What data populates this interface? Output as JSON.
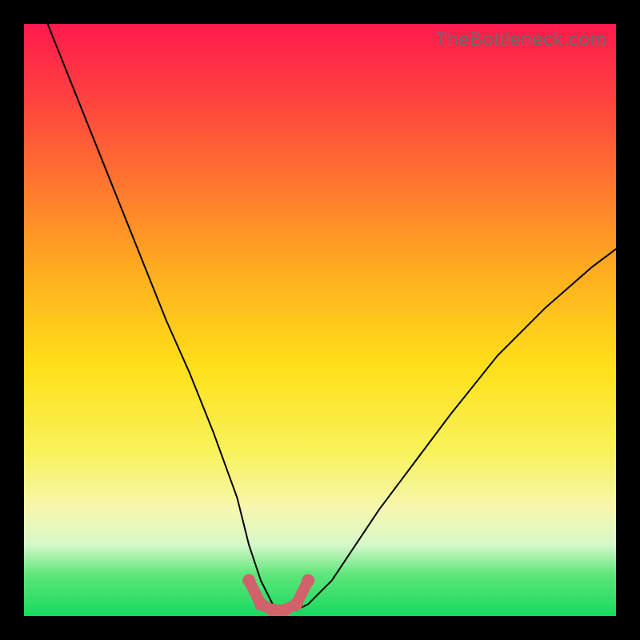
{
  "watermark": "TheBottleneck.com",
  "chart_data": {
    "type": "line",
    "title": "",
    "xlabel": "",
    "ylabel": "",
    "xlim": [
      0,
      100
    ],
    "ylim": [
      0,
      100
    ],
    "series": [
      {
        "name": "bottleneck-curve",
        "x": [
          4,
          8,
          12,
          16,
          20,
          24,
          28,
          32,
          36,
          38,
          40,
          42,
          44,
          46,
          48,
          52,
          56,
          60,
          66,
          72,
          80,
          88,
          96,
          100
        ],
        "y": [
          100,
          90,
          80,
          70,
          60,
          50,
          41,
          31,
          20,
          12,
          6,
          2,
          1,
          1,
          2,
          6,
          12,
          18,
          26,
          34,
          44,
          52,
          59,
          62
        ]
      },
      {
        "name": "highlight-segment",
        "x": [
          38,
          40,
          42,
          44,
          46,
          48
        ],
        "y": [
          6,
          2,
          1,
          1,
          2,
          6
        ]
      }
    ],
    "gradient_stops": [
      {
        "pos": 0,
        "color": "#ff1a4d"
      },
      {
        "pos": 12,
        "color": "#ff4040"
      },
      {
        "pos": 28,
        "color": "#ff7a2e"
      },
      {
        "pos": 42,
        "color": "#ffae1f"
      },
      {
        "pos": 58,
        "color": "#ffe01a"
      },
      {
        "pos": 72,
        "color": "#f8f25a"
      },
      {
        "pos": 82,
        "color": "#f6f7b0"
      },
      {
        "pos": 88,
        "color": "#d6f8c8"
      },
      {
        "pos": 93,
        "color": "#5ee67a"
      },
      {
        "pos": 100,
        "color": "#17d95e"
      }
    ]
  }
}
